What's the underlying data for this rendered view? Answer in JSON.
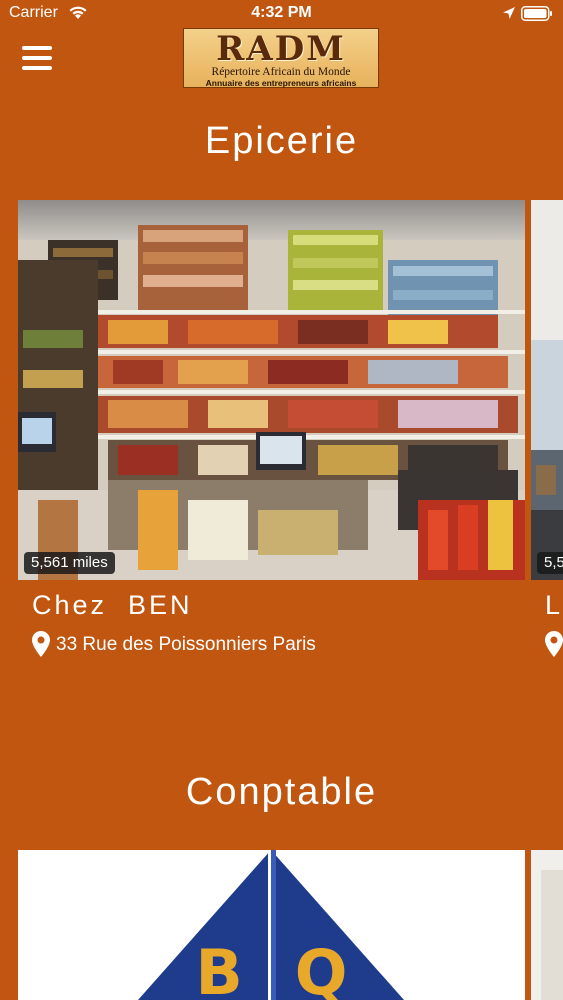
{
  "status_bar": {
    "carrier": "Carrier",
    "time": "4:32 PM",
    "icons": [
      "wifi-icon",
      "location-arrow-icon",
      "battery-icon"
    ]
  },
  "header": {
    "menu_icon": "hamburger-menu-icon",
    "logo": {
      "title": "RADM",
      "subtitle": "Répertoire Africain du Monde",
      "tagline": "Annuaire des entrepreneurs africains"
    }
  },
  "sections": [
    {
      "title": "Epicerie",
      "cards": [
        {
          "name": "Chez  BEN",
          "distance": "5,561 miles",
          "address": "33 Rue des Poissonniers Paris"
        },
        {
          "name": "L",
          "distance": "5,5"
        }
      ]
    },
    {
      "title": "Conptable",
      "cards": [
        {
          "logo_letters": "BQ"
        },
        {}
      ]
    }
  ],
  "colors": {
    "background": "#C0560F",
    "text": "#FFFFFF",
    "badge": "#1A1A1A"
  }
}
